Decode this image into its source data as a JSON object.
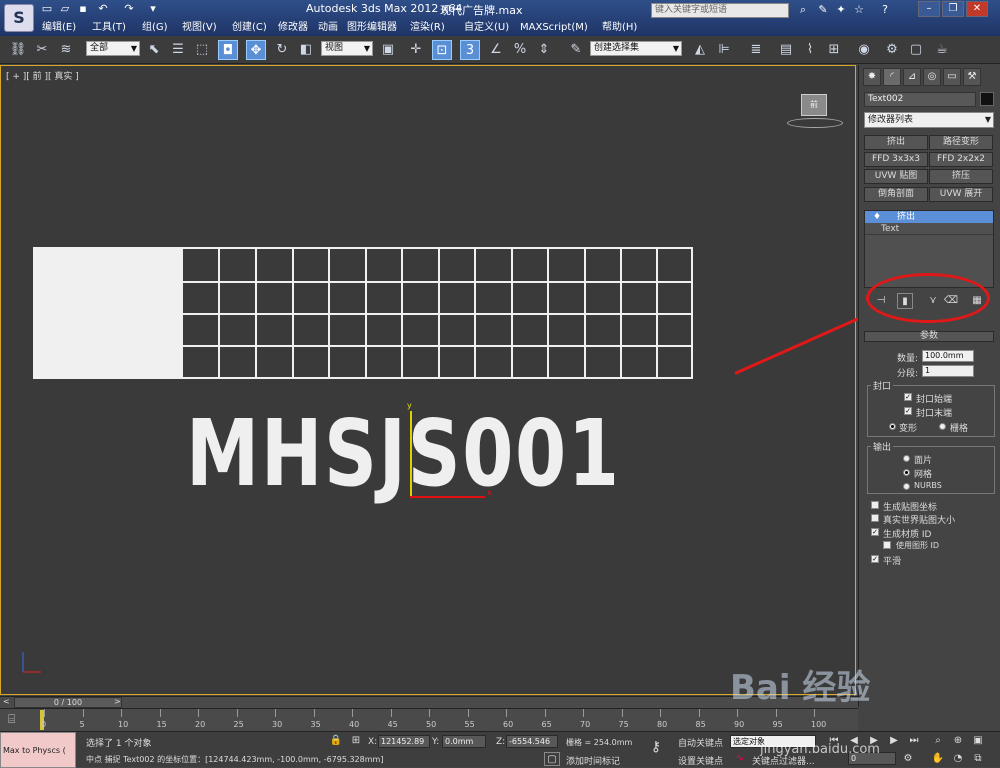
{
  "title_bar": {
    "app_title": "Autodesk 3ds Max  2012 x64",
    "doc_name": "现代广告牌.max",
    "search_placeholder": "键入关键字或短语",
    "logo": "S"
  },
  "menu": [
    "编辑(E)",
    "工具(T)",
    "组(G)",
    "视图(V)",
    "创建(C)",
    "修改器",
    "动画",
    "图形编辑器",
    "渲染(R)",
    "自定义(U)",
    "MAXScript(M)",
    "帮助(H)"
  ],
  "toolbar": {
    "selection_filter": "全部",
    "ref_coord": "视图",
    "named_selection": "创建选择集",
    "icon_names": [
      "link-icon",
      "unlink-icon",
      "bind-icon",
      "select-icon",
      "select-by-name-icon",
      "rect-region-icon",
      "window-crossing-icon",
      "move-icon",
      "rotate-icon",
      "scale-icon",
      "pivot-icon",
      "manipulate-icon",
      "snap-3d-icon",
      "angle-snap-icon",
      "percent-snap-icon",
      "spinner-snap-icon",
      "edit-named-sel-icon",
      "mirror-icon",
      "align-icon",
      "layer-icon",
      "graphite-icon",
      "curve-editor-icon",
      "schematic-icon",
      "material-editor-icon",
      "render-setup-icon",
      "rendered-frame-icon",
      "render-icon"
    ]
  },
  "viewport": {
    "label": "[ + ][ 前 ][ 真实 ]",
    "text_object": "MHSJS001",
    "viewcube_label": "前",
    "gizmo_x": "x",
    "gizmo_y": "y"
  },
  "command_panel": {
    "object_name": "Text002",
    "modifier_list": "修改器列表",
    "modifier_buttons": [
      "挤出",
      "路径变形",
      "FFD 3x3x3",
      "FFD 2x2x2",
      "UVW 贴图",
      "挤压",
      "倒角剖面",
      "UVW 展开"
    ],
    "stack_selected": "挤出",
    "stack_sub": "Text",
    "rollout_title": "参数",
    "amount_label": "数量:",
    "amount_value": "100.0mm",
    "segments_label": "分段:",
    "segments_value": "1",
    "capping_title": "封口",
    "cap_start": "封口始端",
    "cap_end": "封口末端",
    "morph": "变形",
    "grid": "栅格",
    "output_title": "输出",
    "out_patch": "面片",
    "out_mesh": "网格",
    "out_nurbs": "NURBS",
    "gen_map_coords": "生成贴图坐标",
    "real_world_map": "真实世界贴图大小",
    "gen_mat_ids": "生成材质 ID",
    "use_shape_ids": "使用图形 ID",
    "smooth": "平滑"
  },
  "timeline": {
    "frame_counter": "0 / 100",
    "ticks": [
      "0",
      "5",
      "10",
      "15",
      "20",
      "25",
      "30",
      "35",
      "40",
      "45",
      "50",
      "55",
      "60",
      "65",
      "70",
      "75",
      "80",
      "85",
      "90",
      "95",
      "100"
    ]
  },
  "status": {
    "maxscript": "Max to Physcs (",
    "selected": "选择了 1 个对象",
    "prompt": "中点 捕捉 Text002 的坐标位置：[124744.423mm, -100.0mm, -6795.328mm]",
    "x_label": "X:",
    "x_value": "121452.89",
    "y_label": "Y:",
    "y_value": "0.0mm",
    "z_label": "Z:",
    "z_value": "-6554.546",
    "grid_value": "栅格 = 254.0mm",
    "auto_key": "自动关键点",
    "set_key": "设置关键点",
    "selected_obj": "选定对象",
    "key_filters": "关键点过滤器...",
    "add_time_tag": "添加时间标记",
    "frame_field": "0"
  },
  "watermark": {
    "text": "Bai 经验",
    "sub": "jingyan.baidu.com"
  }
}
